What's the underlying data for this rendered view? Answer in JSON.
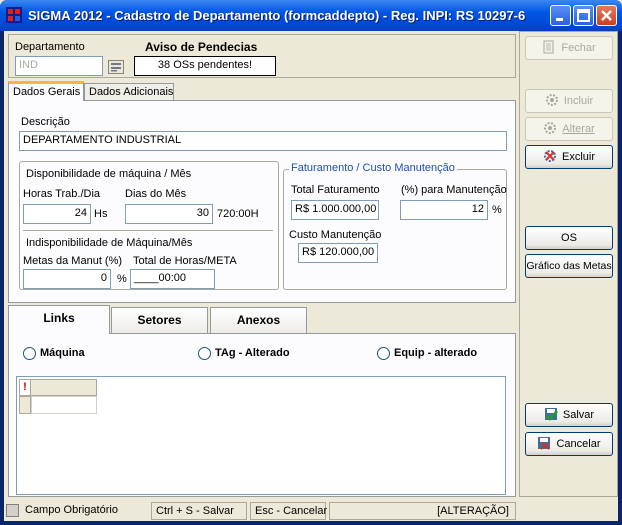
{
  "window": {
    "title": "SIGMA 2012 - Cadastro de Departamento  (formcaddepto)  - Reg. INPI: RS 10297-6"
  },
  "header": {
    "departamento_label": "Departamento",
    "departamento_value": "IND",
    "aviso_label": "Aviso de Pendecias",
    "aviso_value": "38  OSs pendentes!"
  },
  "tabs": [
    "Dados Gerais",
    "Dados Adicionais"
  ],
  "dados_gerais": {
    "descricao_label": "Descrição",
    "descricao_value": "DEPARTAMENTO INDUSTRIAL",
    "disp_title": "Disponibilidade de máquina / Mês",
    "horas_label": "Horas Trab./Dia",
    "horas_value": "24",
    "horas_unit": "Hs",
    "dias_label": "Dias do Mês",
    "dias_value": "30",
    "dias_total": "720:00H",
    "indisp_title": "Indisponibilidade de Máquina/Mês",
    "metas_label": "Metas da Manut (%)",
    "metas_value": "0",
    "metas_unit": "%",
    "total_meta_label": "Total de Horas/META",
    "total_meta_value": "____00:00",
    "fat_title": "Faturamento / Custo Manutenção",
    "total_fat_label": "Total Faturamento",
    "total_fat_value": "R$ 1.000.000,00",
    "pct_manut_label": "(%) para Manutenção",
    "pct_manut_value": "12",
    "pct_unit": "%",
    "custo_label": "Custo Manutenção",
    "custo_value": "R$ 120.000,00"
  },
  "bottom_tabs": [
    "Links",
    "Setores",
    "Anexos"
  ],
  "links": {
    "radio_maquina": "Máquina",
    "radio_tag": "TAg - Alterado",
    "radio_equip": "Equip - alterado",
    "grid_flag": "!"
  },
  "sidebar": {
    "fechar": "Fechar",
    "incluir": "Incluir",
    "alterar": "Alterar",
    "excluir": "Excluir",
    "os": "OS",
    "grafico": "Gráfico das Metas",
    "salvar": "Salvar",
    "cancelar": "Cancelar"
  },
  "statusbar": {
    "campo": "Campo Obrigatório",
    "salvar": "Ctrl + S - Salvar",
    "cancelar": "Esc - Cancelar",
    "modo": "[ALTERAÇÃO]"
  },
  "colors": {
    "titlebar": "#0055e5",
    "window_bg": "#ece9d8",
    "fat_group_title": "#1f4fa8"
  }
}
